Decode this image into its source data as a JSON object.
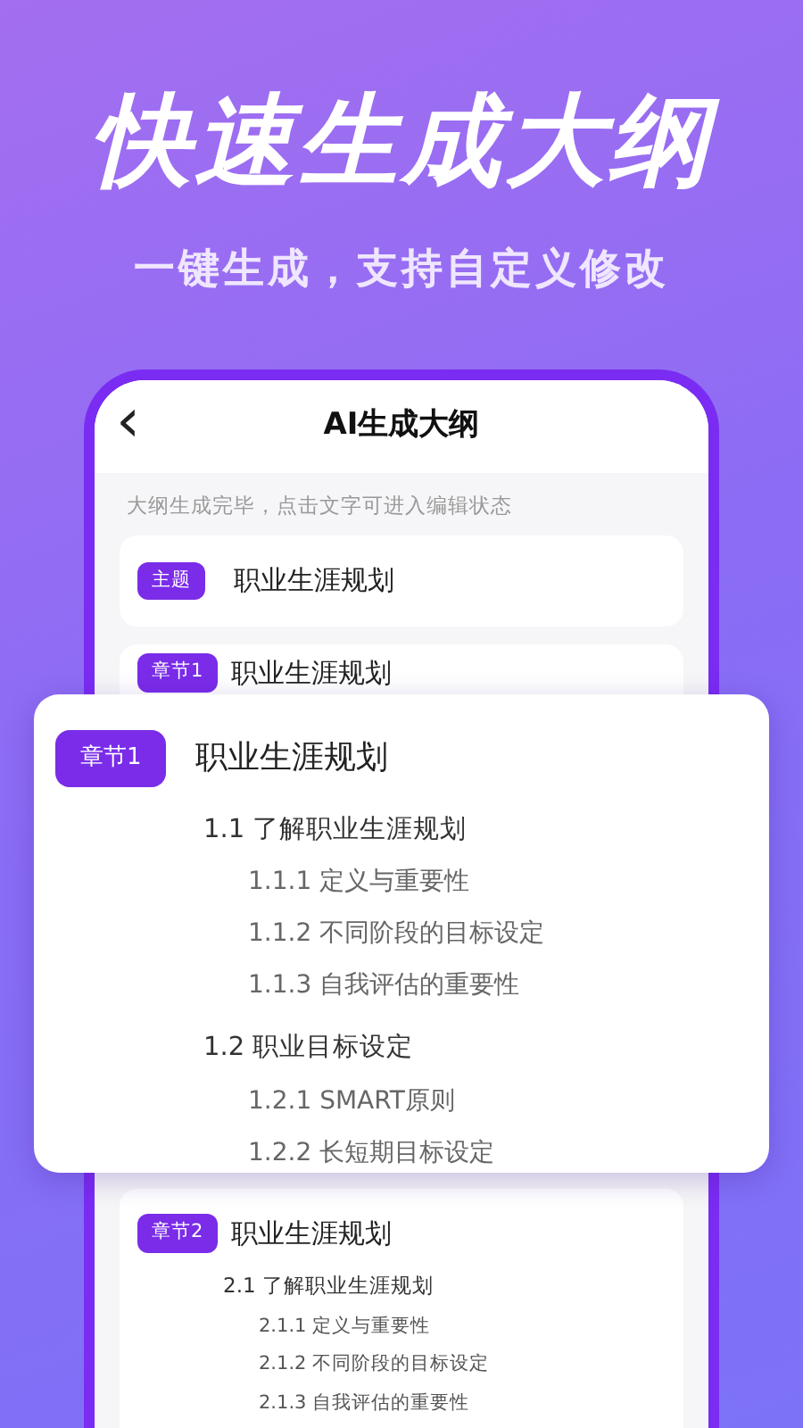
{
  "headline": "快速生成大纲",
  "subheadline": "一键生成，支持自定义修改",
  "app": {
    "back": "‹",
    "title": "AI生成大纲",
    "hint": "大纲生成完毕，点击文字可进入编辑状态",
    "topic": {
      "tag": "主题",
      "text": "职业生涯规划"
    },
    "chapters": [
      {
        "tag": "章节1",
        "title": "职业生涯规划"
      },
      {
        "tag": "章节2",
        "title": "职业生涯规划",
        "sections": [
          {
            "title": "2.1 了解职业生涯规划",
            "children": [
              {
                "title": "2.1.1 定义与重要性"
              },
              {
                "title": "2.1.2 不同阶段的目标设定"
              },
              {
                "title": "2.1.3 自我评估的重要性"
              }
            ]
          }
        ]
      }
    ]
  },
  "popup": {
    "tag": "章节1",
    "title": "职业生涯规划",
    "sections": [
      {
        "title": "1.1 了解职业生涯规划",
        "children": [
          {
            "title": "1.1.1 定义与重要性"
          },
          {
            "title": "1.1.2 不同阶段的目标设定"
          },
          {
            "title": "1.1.3 自我评估的重要性"
          }
        ]
      },
      {
        "title": "1.2 职业目标设定",
        "children": [
          {
            "title": "1.2.1 SMART原则"
          },
          {
            "title": "1.2.2 长短期目标设定"
          }
        ]
      }
    ]
  }
}
